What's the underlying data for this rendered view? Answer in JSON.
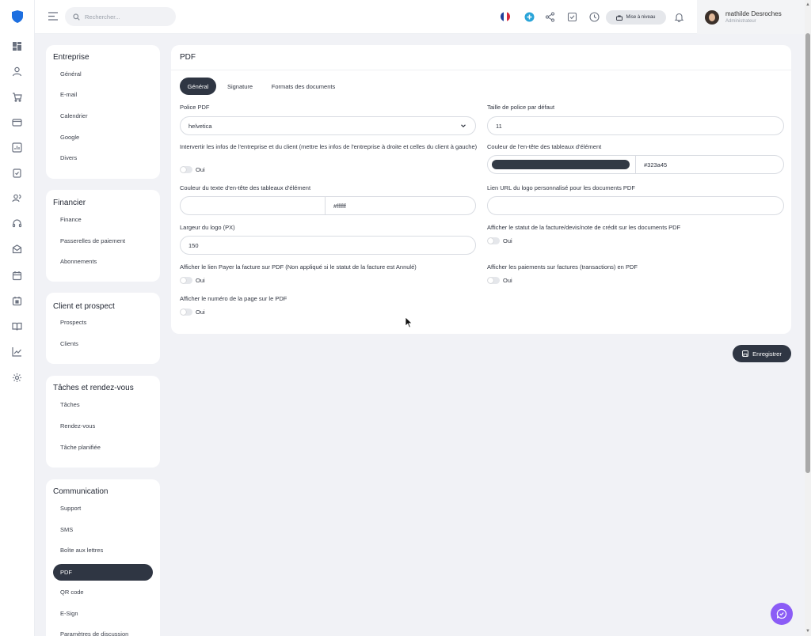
{
  "header": {
    "search_placeholder": "Rechercher...",
    "upgrade_label": "Mise à niveau",
    "user_name": "mathilde Desroches",
    "user_role": "Administrateur"
  },
  "sidebar": {
    "groups": [
      {
        "title": "Entreprise",
        "items": [
          "Général",
          "E-mail",
          "Calendrier",
          "Google",
          "Divers"
        ]
      },
      {
        "title": "Financier",
        "items": [
          "Finance",
          "Passerelles de paiement",
          "Abonnements"
        ]
      },
      {
        "title": "Client et prospect",
        "items": [
          "Prospects",
          "Clients"
        ]
      },
      {
        "title": "Tâches et rendez-vous",
        "items": [
          "Tâches",
          "Rendez-vous",
          "Tâche planifiée"
        ]
      },
      {
        "title": "Communication",
        "items": [
          "Support",
          "SMS",
          "Boîte aux lettres",
          "PDF",
          "QR code",
          "E-Sign",
          "Paramètres de discussion"
        ]
      }
    ],
    "active_item": "PDF"
  },
  "main": {
    "title": "PDF",
    "tabs": [
      "Général",
      "Signature",
      "Formats des documents"
    ],
    "active_tab": "Général",
    "fields": {
      "pdf_font_label": "Police PDF",
      "pdf_font_value": "helvetica",
      "font_size_label": "Taille de police par défaut",
      "font_size_value": "11",
      "swap_info_label": "Intervertir les infos de l'entreprise et du client (mettre les infos de l'entreprise à droite et celles du client à gauche)",
      "table_header_color_label": "Couleur de l'en-tête des tableaux d'élément",
      "table_header_color_value": "#323a45",
      "table_header_text_color_label": "Couleur du texte d'en-tête des tableaux d'élément",
      "table_header_text_color_value": "#ffffff",
      "logo_url_label": "Lien URL du logo personnalisé pour les documents PDF",
      "logo_url_value": "",
      "logo_width_label": "Largeur du logo (PX)",
      "logo_width_value": "150",
      "show_status_label": "Afficher le statut de la facture/devis/note de crédit sur les documents PDF",
      "show_pay_link_label": "Afficher le lien Payer la facture sur PDF (Non appliqué si le statut de la facture est Annulé)",
      "show_payments_label": "Afficher les paiements sur factures (transactions) en PDF",
      "show_page_number_label": "Afficher le numéro de la page sur le PDF",
      "toggle_label": "Oui"
    },
    "save_label": "Enregistrer"
  },
  "colors": {
    "dark": "#2f3643",
    "accent": "#323a45",
    "chat": "#8b5cf6",
    "brand": "#1d6fe0"
  },
  "icons": {
    "rail": [
      "dashboard-icon",
      "user-icon",
      "cart-icon",
      "wallet-icon",
      "chart-icon",
      "clipboard-icon",
      "users-icon",
      "headset-icon",
      "envelope-icon",
      "calendar-icon",
      "calendar-check-icon",
      "book-icon",
      "trend-icon",
      "gear-icon"
    ],
    "topbar": [
      "flag-fr-icon",
      "plus-circle-icon",
      "share-icon",
      "checkbox-icon",
      "clock-icon",
      "bell-icon"
    ]
  }
}
